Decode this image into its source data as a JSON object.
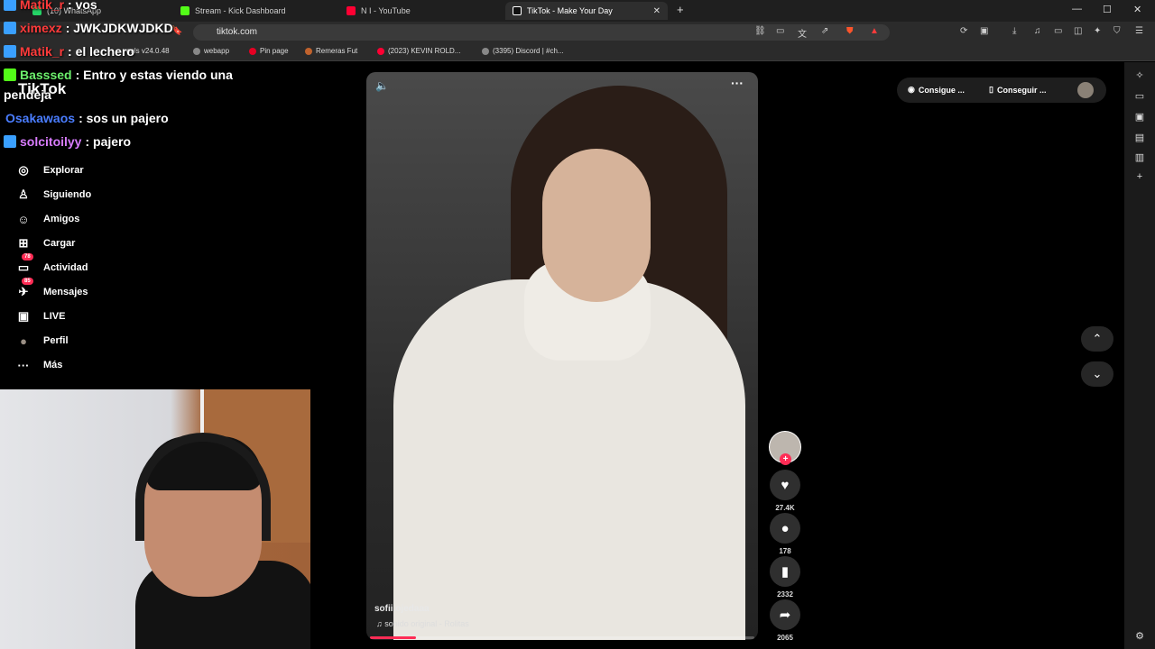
{
  "browser": {
    "tabs": [
      {
        "title": "(10) WhatsApp",
        "active": false,
        "color": "#25d366"
      },
      {
        "title": "Stream - Kick Dashboard",
        "active": false,
        "color": "#53fc18"
      },
      {
        "title": "N I - YouTube",
        "active": false,
        "color": "#ff0033"
      },
      {
        "title": "TikTok - Make Your Day",
        "active": true,
        "color": "#ffffff"
      }
    ],
    "new_tab": "+",
    "url": "tiktok.com",
    "bookmarks": [
      {
        "label": "ools v24.0.48",
        "color": "#888888"
      },
      {
        "label": "webapp",
        "color": "#888888"
      },
      {
        "label": "Pin page",
        "color": "#e60023"
      },
      {
        "label": "Remeras Fut",
        "color": "#c0622d"
      },
      {
        "label": "(2023) KEVIN ROLD...",
        "color": "#ff0033"
      },
      {
        "label": "(3395) Discord | #ch...",
        "color": "#888888"
      }
    ],
    "window_controls": [
      "—",
      "☐",
      "✕"
    ]
  },
  "chat": [
    {
      "user": "Matik_r",
      "text": ": vos",
      "user_color": "#ff3b3b",
      "badge_color": "#3aa0ff"
    },
    {
      "user": "ximexz",
      "text": ": JWKJDKWJDKD",
      "user_color": "#ff3b3b",
      "badge_color": "#3aa0ff"
    },
    {
      "user": "Matik_r",
      "text": ": el lechero",
      "user_color": "#ff3b3b",
      "badge_color": "#3aa0ff"
    },
    {
      "user": "Basssed",
      "text": ": Entro y estas viendo una",
      "user_color": "#6cf06c",
      "badge_color": "#53fc18"
    },
    {
      "user": "",
      "text": "pendeja",
      "user_color": "#ffffff",
      "badge_color": ""
    },
    {
      "user": "Osakawaos",
      "text": ": sos un pajero",
      "user_color": "#4a7dff",
      "badge_color": ""
    },
    {
      "user": "solcitoilyy",
      "text": ": pajero",
      "user_color": "#d97cff",
      "badge_color": "#3aa0ff"
    }
  ],
  "tiktok": {
    "logo": "TikTok",
    "nav": [
      {
        "label": "Explorar",
        "icon": "compass-icon",
        "glyph": "◎",
        "badge": ""
      },
      {
        "label": "Siguiendo",
        "icon": "following-icon",
        "glyph": "♙",
        "badge": ""
      },
      {
        "label": "Amigos",
        "icon": "friends-icon",
        "glyph": "☺",
        "badge": ""
      },
      {
        "label": "Cargar",
        "icon": "upload-icon",
        "glyph": "⊞",
        "badge": ""
      },
      {
        "label": "Actividad",
        "icon": "activity-icon",
        "glyph": "▭",
        "badge": "78"
      },
      {
        "label": "Mensajes",
        "icon": "messages-icon",
        "glyph": "✈",
        "badge": "85"
      },
      {
        "label": "LIVE",
        "icon": "live-icon",
        "glyph": "▣",
        "badge": ""
      },
      {
        "label": "Perfil",
        "icon": "profile-avatar-icon",
        "glyph": "●",
        "badge": ""
      },
      {
        "label": "Más",
        "icon": "more-icon",
        "glyph": "···",
        "badge": ""
      }
    ],
    "top_buttons": [
      "Consigue ...",
      "Conseguir ..."
    ],
    "video": {
      "author": "sofii.ojedaaa",
      "sound": "sonido original - Rolitas",
      "progress": 0.12
    },
    "actions": [
      {
        "name": "like",
        "glyph": "♥",
        "count": "27.4K"
      },
      {
        "name": "comment",
        "glyph": "●",
        "count": "178"
      },
      {
        "name": "bookmark",
        "glyph": "▮",
        "count": "2332"
      },
      {
        "name": "share",
        "glyph": "➦",
        "count": "2065"
      }
    ]
  },
  "colors": {
    "accent": "#fe2c55",
    "background": "#000000"
  }
}
